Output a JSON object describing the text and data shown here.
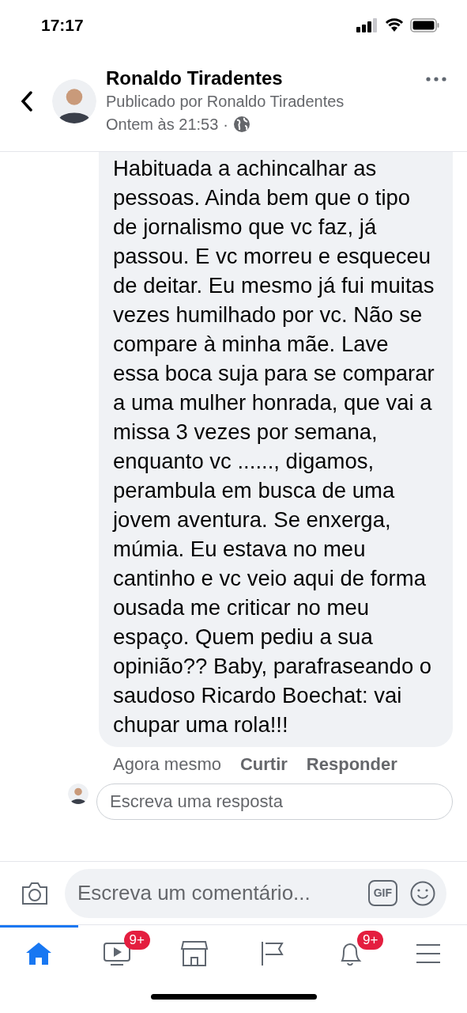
{
  "status_bar": {
    "time": "17:17"
  },
  "header": {
    "name": "Ronaldo Tiradentes",
    "subtitle": "Publicado por Ronaldo Tiradentes",
    "time": "Ontem às 21:53",
    "separator": "·"
  },
  "comment": {
    "text": "Habituada a achincalhar as pessoas. Ainda bem que o tipo de jornalismo que vc faz, já passou. E vc morreu e esqueceu de deitar. Eu mesmo já fui muitas vezes humilhado por vc. Não se compare à minha mãe. Lave essa boca suja para se comparar a uma mulher honrada, que vai a missa 3 vezes por semana, enquanto vc ......, digamos, perambula em busca de uma jovem aventura. Se enxerga, múmia. Eu estava no meu cantinho e vc veio aqui de forma ousada me criticar no meu espaço. Quem pediu a sua opinião?? Baby, parafraseando o saudoso Ricardo Boechat: vai chupar uma rola!!!",
    "time": "Agora mesmo",
    "actions": [
      "Curtir",
      "Responder"
    ]
  },
  "reply": {
    "placeholder": "Escreva uma resposta"
  },
  "composer": {
    "placeholder": "Escreva um comentário...",
    "gif": "GIF"
  },
  "tabs": [
    {
      "kind": "home",
      "selected": true
    },
    {
      "kind": "video",
      "selected": false,
      "badge": "9+"
    },
    {
      "kind": "market",
      "selected": false
    },
    {
      "kind": "pages",
      "selected": false
    },
    {
      "kind": "bell",
      "selected": false,
      "badge": "9+"
    },
    {
      "kind": "menu",
      "selected": false
    }
  ]
}
